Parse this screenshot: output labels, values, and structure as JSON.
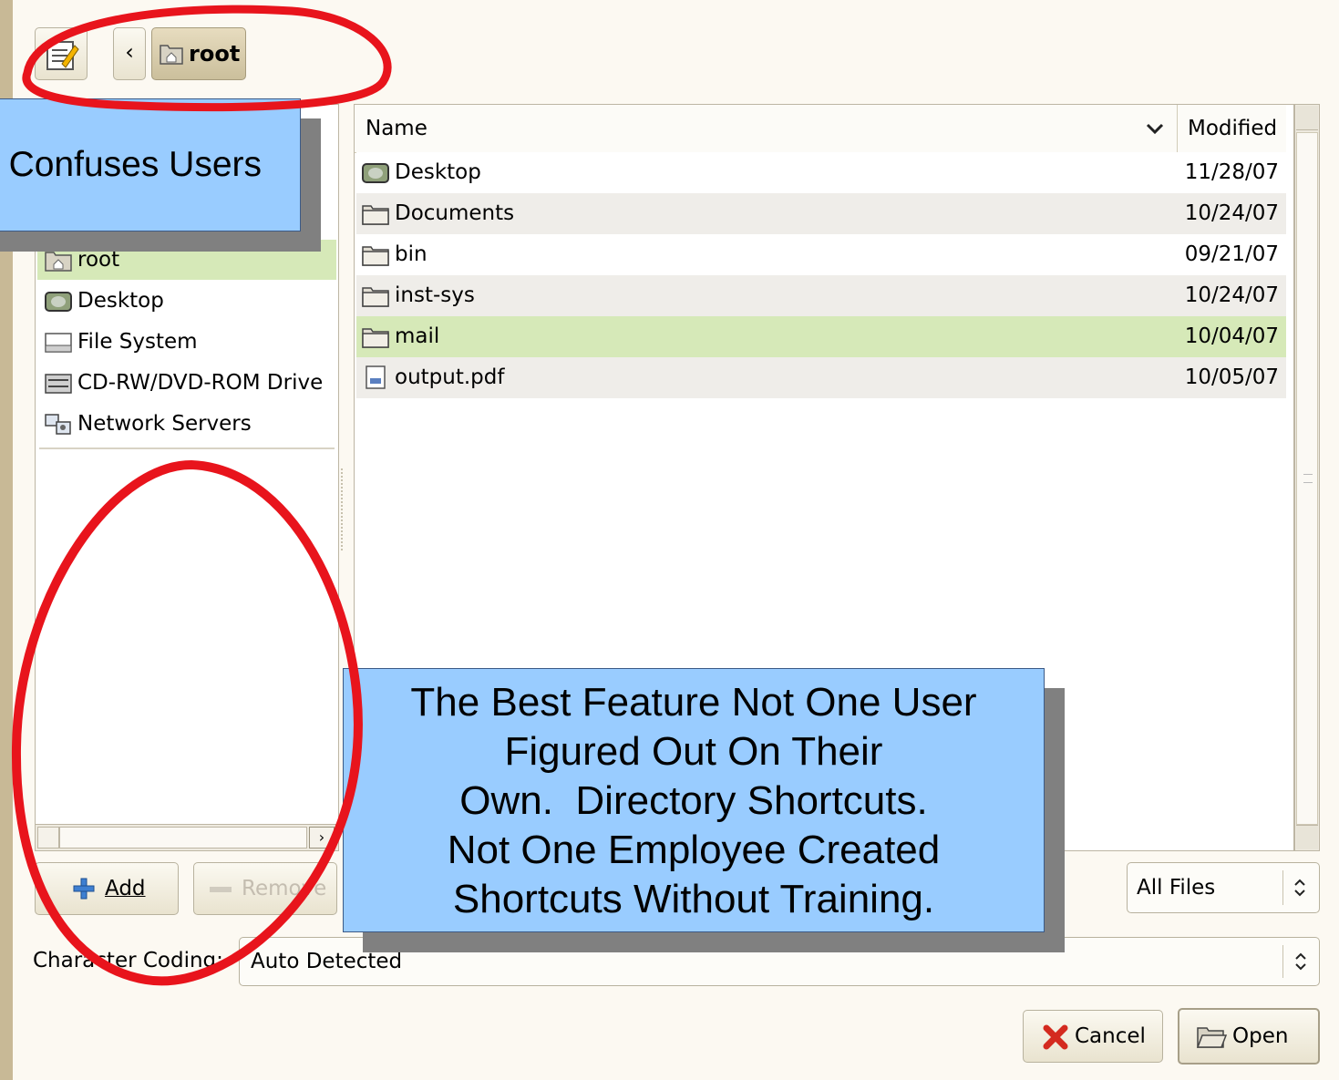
{
  "toolbar": {
    "path_label": "root",
    "back_glyph": "‹"
  },
  "callouts": {
    "top": "Confuses Users",
    "bottom_lines": [
      "The Best Feature Not One User",
      "Figured Out On Their",
      "Own.  Directory Shortcuts.",
      "Not One Employee Created",
      "Shortcuts Without Training."
    ]
  },
  "places": {
    "items": [
      {
        "label": "root",
        "icon": "home-folder-icon"
      },
      {
        "label": "Desktop",
        "icon": "desktop-icon"
      },
      {
        "label": "File System",
        "icon": "drive-icon"
      },
      {
        "label": "CD-RW/DVD-ROM Drive",
        "icon": "cdrom-icon"
      },
      {
        "label": "Network Servers",
        "icon": "network-icon"
      }
    ],
    "selected": "root"
  },
  "buttons": {
    "add": "Add",
    "remove": "Remove",
    "cancel": "Cancel",
    "open": "Open"
  },
  "files": {
    "columns": {
      "name": "Name",
      "modified": "Modified"
    },
    "rows": [
      {
        "name": "Desktop",
        "modified": "11/28/07",
        "icon": "desktop-icon"
      },
      {
        "name": "Documents",
        "modified": "10/24/07",
        "icon": "folder-icon"
      },
      {
        "name": "bin",
        "modified": "09/21/07",
        "icon": "folder-icon"
      },
      {
        "name": "inst-sys",
        "modified": "10/24/07",
        "icon": "folder-icon"
      },
      {
        "name": "mail",
        "modified": "10/04/07",
        "icon": "folder-icon"
      },
      {
        "name": "output.pdf",
        "modified": "10/05/07",
        "icon": "document-icon"
      }
    ],
    "selected": "mail"
  },
  "filter": {
    "value": "All Files"
  },
  "encoding": {
    "label": "Character Coding:",
    "value": "Auto Detected"
  },
  "colors": {
    "selection": "#d6e9b8",
    "callout_fill": "#99ccff",
    "annotation_red": "#e8141c"
  }
}
